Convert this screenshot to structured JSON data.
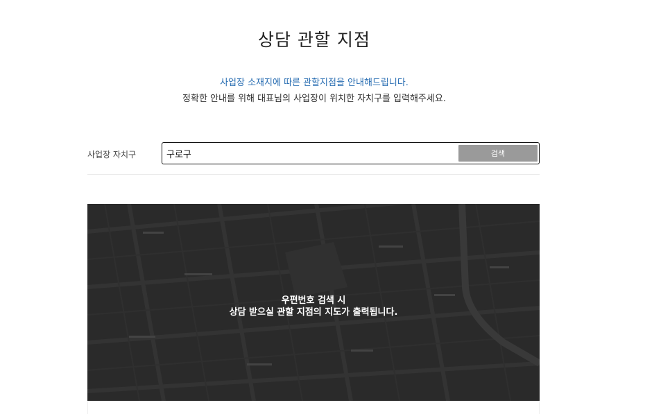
{
  "page": {
    "title": "상담 관할 지점",
    "intro_line1": "사업장 소재지에 따른 관할지점을 안내해드립니다.",
    "intro_line2": "정확한 안내를 위해 대표님의 사업장이 위치한 자치구를 입력해주세요."
  },
  "search": {
    "label": "사업장 자치구",
    "value": "구로구",
    "button_label": "검색"
  },
  "map": {
    "message_line1": "우편번호 검색 시",
    "message_line2": "상담 받으실 관할 지점의 지도가 출력됩니다."
  },
  "colors": {
    "accent_text": "#2b6fb3",
    "button_bg": "#9a9a9a",
    "map_bg": "#3c3c3c"
  }
}
